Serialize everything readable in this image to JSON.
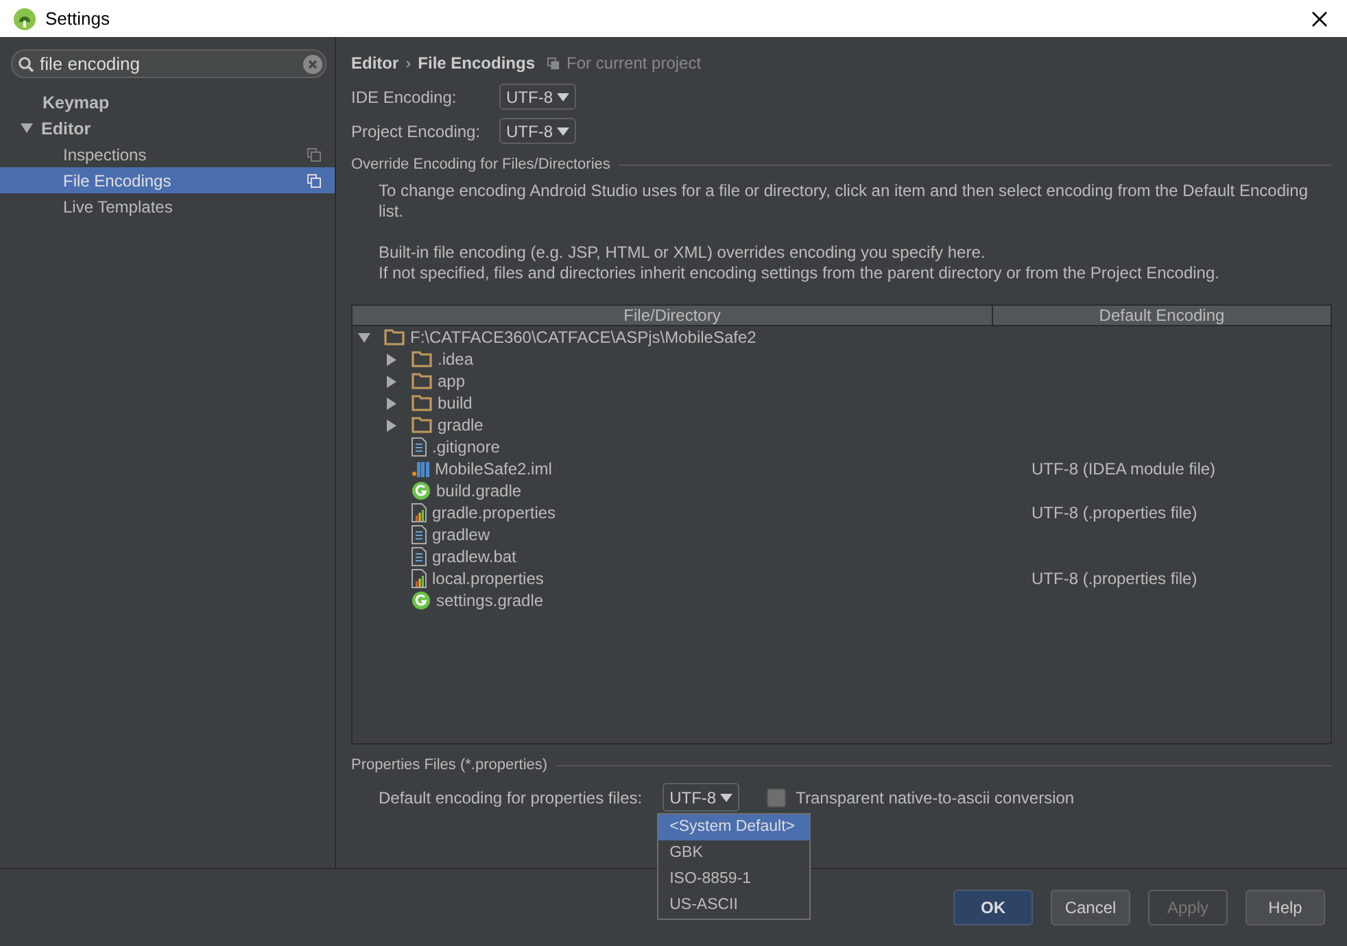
{
  "window": {
    "title": "Settings"
  },
  "search": {
    "value": "file encoding"
  },
  "sidebar": {
    "items": [
      {
        "label": "Keymap",
        "selected": false
      },
      {
        "label": "Editor",
        "selected": false,
        "expanded": true,
        "children": [
          {
            "label": "Inspections",
            "selected": false,
            "scoped": true
          },
          {
            "label": "File Encodings",
            "selected": true,
            "scoped": true
          },
          {
            "label": "Live Templates",
            "selected": false,
            "scoped": false
          }
        ]
      }
    ]
  },
  "breadcrumb": {
    "items": [
      "Editor",
      "File Encodings"
    ],
    "separator": "›",
    "scope": "For current project"
  },
  "encodings": [
    {
      "label": "IDE Encoding:",
      "value": "UTF-8"
    },
    {
      "label": "Project Encoding:",
      "value": "UTF-8"
    }
  ],
  "override": {
    "title": "Override Encoding for Files/Directories",
    "paragraphs": [
      [
        "To change encoding Android Studio uses for a file or directory, click an item and then select encoding from the Default Encoding list."
      ],
      [
        "Built-in file encoding (e.g. JSP, HTML or XML) overrides encoding you specify here.",
        "If not specified, files and directories inherit encoding settings from the parent directory or from the Project Encoding."
      ]
    ],
    "table": {
      "columns": [
        "File/Directory",
        "Default Encoding"
      ],
      "rows": [
        {
          "name": "F:\\CATFACE360\\CATFACE\\ASPjs\\MobileSafe2",
          "kind": "folder",
          "expanded": true,
          "children": [
            {
              "name": ".idea",
              "kind": "folder",
              "expanded": false
            },
            {
              "name": "app",
              "kind": "folder",
              "expanded": false
            },
            {
              "name": "build",
              "kind": "folder",
              "expanded": false
            },
            {
              "name": "gradle",
              "kind": "folder",
              "expanded": false
            },
            {
              "name": ".gitignore",
              "kind": "text"
            },
            {
              "name": "MobileSafe2.iml",
              "kind": "module",
              "encoding": "UTF-8 (IDEA module file)"
            },
            {
              "name": "build.gradle",
              "kind": "gradle"
            },
            {
              "name": "gradle.properties",
              "kind": "properties",
              "encoding": "UTF-8 (.properties file)"
            },
            {
              "name": "gradlew",
              "kind": "text"
            },
            {
              "name": "gradlew.bat",
              "kind": "text"
            },
            {
              "name": "local.properties",
              "kind": "properties",
              "encoding": "UTF-8 (.properties file)"
            },
            {
              "name": "settings.gradle",
              "kind": "gradle"
            }
          ]
        }
      ]
    }
  },
  "properties": {
    "title": "Properties Files (*.properties)",
    "label": "Default encoding for properties files:",
    "value": "UTF-8",
    "checkbox": {
      "label": "Transparent native-to-ascii conversion",
      "checked": false
    },
    "options": [
      {
        "label": "<System Default>",
        "selected": true
      },
      {
        "label": "GBK",
        "selected": false
      },
      {
        "label": "ISO-8859-1",
        "selected": false
      },
      {
        "label": "US-ASCII",
        "selected": false
      }
    ]
  },
  "buttons": [
    {
      "label": "OK",
      "kind": "primary",
      "disabled": false
    },
    {
      "label": "Cancel",
      "kind": "normal",
      "disabled": false
    },
    {
      "label": "Apply",
      "kind": "normal",
      "disabled": true
    },
    {
      "label": "Help",
      "kind": "normal",
      "disabled": false
    }
  ]
}
